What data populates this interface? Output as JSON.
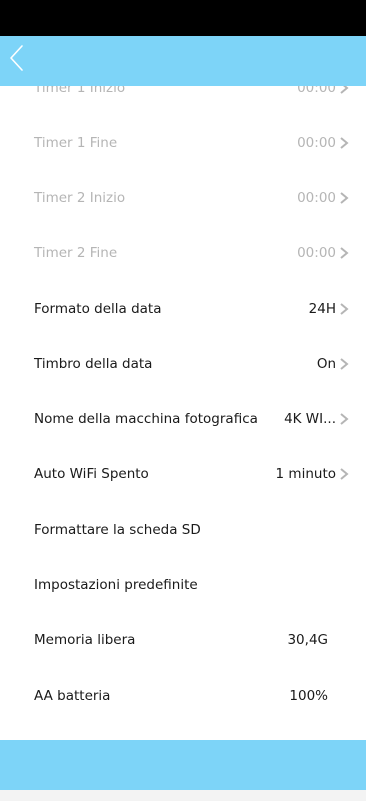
{
  "header": {
    "back_icon": "chevron-left-icon",
    "color": "#7dd4f8"
  },
  "settings": [
    {
      "label": "Timer 1 Inizio",
      "value": "00:00",
      "chevron": true,
      "disabled": true
    },
    {
      "label": "Timer 1 Fine",
      "value": "00:00",
      "chevron": true,
      "disabled": true
    },
    {
      "label": "Timer 2 Inizio",
      "value": "00:00",
      "chevron": true,
      "disabled": true
    },
    {
      "label": "Timer 2 Fine",
      "value": "00:00",
      "chevron": true,
      "disabled": true
    },
    {
      "label": "Formato della data",
      "value": "24H",
      "chevron": true,
      "disabled": false
    },
    {
      "label": "Timbro della data",
      "value": "On",
      "chevron": true,
      "disabled": false
    },
    {
      "label": "Nome della macchina fotografica",
      "value": "4K WI...",
      "chevron": true,
      "disabled": false
    },
    {
      "label": "Auto WiFi Spento",
      "value": "1 minuto",
      "chevron": true,
      "disabled": false
    },
    {
      "label": "Formattare la scheda SD",
      "value": "",
      "chevron": false,
      "disabled": false
    },
    {
      "label": "Impostazioni predefinite",
      "value": "",
      "chevron": false,
      "disabled": false
    },
    {
      "label": "Memoria libera",
      "value": "30,4G",
      "chevron": false,
      "disabled": false
    },
    {
      "label": "AA batteria",
      "value": "100%",
      "chevron": false,
      "disabled": false
    }
  ]
}
